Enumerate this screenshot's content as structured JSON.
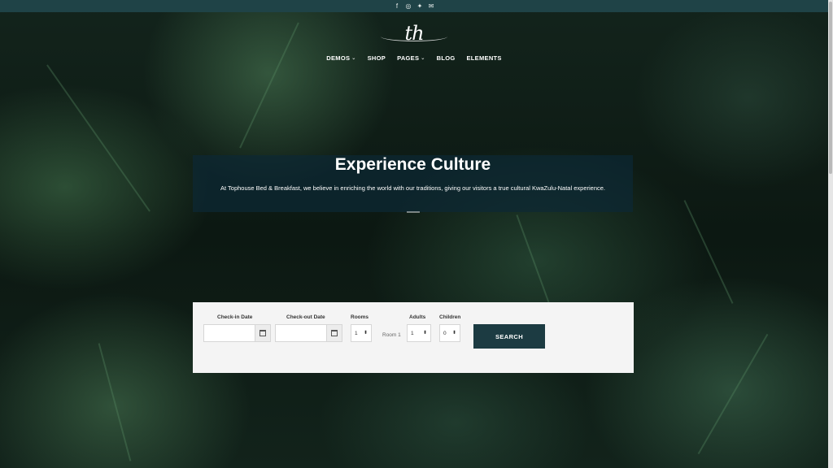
{
  "topbar": {
    "social_icons": [
      {
        "name": "facebook-icon",
        "glyph": "f"
      },
      {
        "name": "instagram-icon",
        "glyph": "◎"
      },
      {
        "name": "twitter-icon",
        "glyph": "✦"
      },
      {
        "name": "email-icon",
        "glyph": "✉"
      }
    ]
  },
  "logo": {
    "mark": "th"
  },
  "nav": {
    "items": [
      {
        "label": "DEMOS",
        "dropdown": "⌄"
      },
      {
        "label": "SHOP",
        "dropdown": ""
      },
      {
        "label": "PAGES",
        "dropdown": "⌄"
      },
      {
        "label": "BLOG",
        "dropdown": ""
      },
      {
        "label": "ELEMENTS",
        "dropdown": ""
      }
    ]
  },
  "hero": {
    "title": "Experience Culture",
    "text": "At Tophouse Bed & Breakfast, we believe in enriching the world with our traditions, giving our visitors a true cultural KwaZulu-Natal experience."
  },
  "booking": {
    "checkin_label": "Check-in Date",
    "checkout_label": "Check-out Date",
    "rooms_label": "Rooms",
    "adults_label": "Adults",
    "children_label": "Children",
    "rooms_value": "1",
    "room_row_label": "Room 1",
    "adults_value": "1",
    "children_value": "0",
    "select_arrow": "⬍",
    "search_label": "SEARCH"
  },
  "colors": {
    "topbar": "#1f4347",
    "search_button": "#1c3b42",
    "hero_overlay": "#0c2834",
    "booking_bg": "#f4f4f4"
  }
}
